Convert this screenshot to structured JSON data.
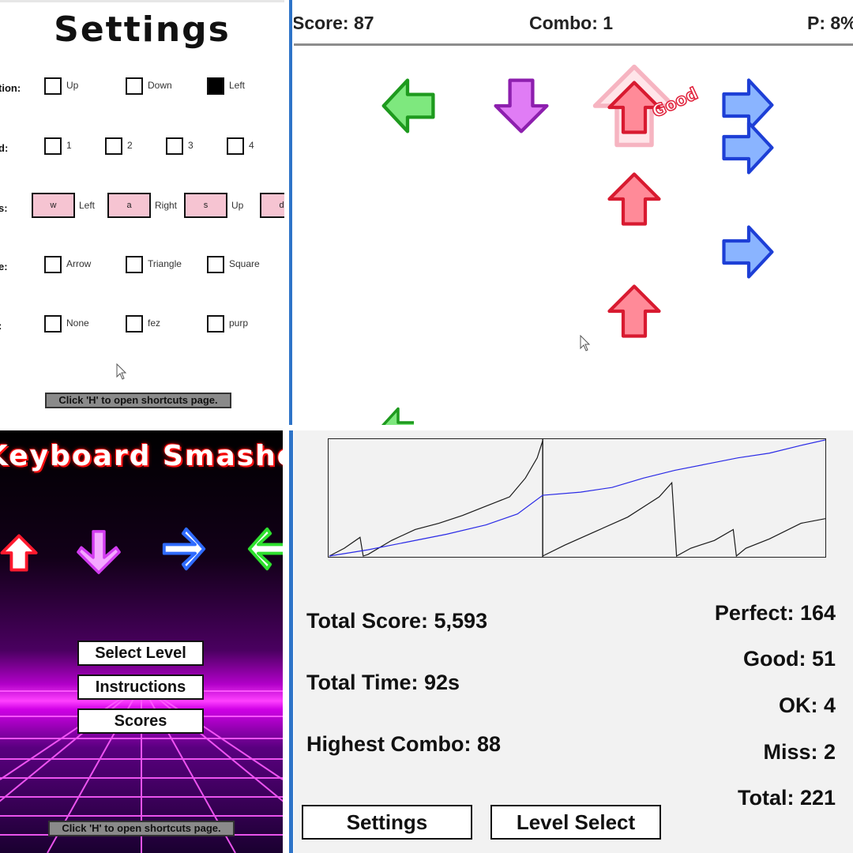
{
  "settings": {
    "title": "Settings",
    "rows": [
      {
        "label": "tion:",
        "options": [
          {
            "label": "Up",
            "checked": false
          },
          {
            "label": "Down",
            "checked": false
          },
          {
            "label": "Left",
            "checked": true
          }
        ]
      },
      {
        "label": "d:",
        "options": [
          {
            "label": "1",
            "checked": false
          },
          {
            "label": "2",
            "checked": false
          },
          {
            "label": "3",
            "checked": false
          },
          {
            "label": "4",
            "checked": false
          }
        ]
      },
      {
        "label": "s:",
        "keys": [
          {
            "key": "w",
            "label": "Left"
          },
          {
            "key": "a",
            "label": "Right"
          },
          {
            "key": "s",
            "label": "Up"
          },
          {
            "key": "d",
            "label": ""
          }
        ]
      },
      {
        "label": "e:",
        "options": [
          {
            "label": "Arrow",
            "checked": false
          },
          {
            "label": "Triangle",
            "checked": false
          },
          {
            "label": "Square",
            "checked": false
          }
        ]
      },
      {
        "label": ":",
        "options": [
          {
            "label": "None",
            "checked": false
          },
          {
            "label": "fez",
            "checked": false
          },
          {
            "label": "purp",
            "checked": false
          }
        ]
      }
    ],
    "shortcut_hint": "Click 'H' to open shortcuts page."
  },
  "gameplay": {
    "score": "Score: 87",
    "combo": "Combo: 1",
    "progress": "P: 8%",
    "judgement": "Good",
    "colors": {
      "left": "#3cc83c",
      "down": "#cc44ee",
      "up": "#e8283a",
      "right": "#3a6af5"
    }
  },
  "menu": {
    "game_title": "Keyboard Smasher",
    "buttons": {
      "select_level": "Select Level",
      "instructions": "Instructions",
      "scores": "Scores"
    },
    "shortcut_hint": "Click 'H' to open shortcuts page."
  },
  "results": {
    "total_score": "Total Score: 5,593",
    "total_time": "Total Time: 92s",
    "highest_combo": "Highest Combo: 88",
    "perfect": "Perfect: 164",
    "good": "Good: 51",
    "ok": "OK: 4",
    "miss": "Miss: 2",
    "total": "Total: 221",
    "settings_button": "Settings",
    "level_select_button": "Level Select"
  }
}
